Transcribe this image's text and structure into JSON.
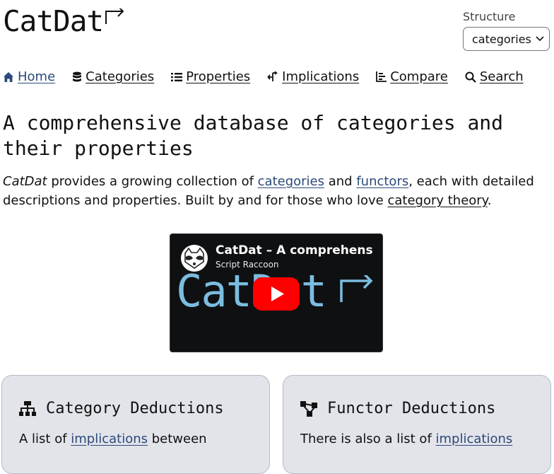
{
  "header": {
    "logo_text": "CatDat"
  },
  "structure": {
    "label": "Structure",
    "selected": "categories"
  },
  "nav": [
    {
      "label": "Home",
      "icon": "home-icon"
    },
    {
      "label": "Categories",
      "icon": "database-icon"
    },
    {
      "label": "Properties",
      "icon": "list-icon"
    },
    {
      "label": "Implications",
      "icon": "implication-icon"
    },
    {
      "label": "Compare",
      "icon": "compare-icon"
    },
    {
      "label": "Search",
      "icon": "search-icon"
    }
  ],
  "main": {
    "title": "A comprehensive database of categories and their properties",
    "intro": {
      "brand": "CatDat",
      "t1": " provides a growing collection of ",
      "link1": "categories",
      "t2": " and ",
      "link2": "functors",
      "t3": ", each with detailed descriptions and properties. Built by and for those who love ",
      "link3": "category theory",
      "t4": "."
    }
  },
  "video": {
    "title": "CatDat – A comprehensive database of categories",
    "channel": "Script Raccoon",
    "thumbnail_text": "CatDat"
  },
  "cards": [
    {
      "title": "Category Deductions",
      "text_before": "A list of ",
      "link": "implications",
      "text_after": " between",
      "icon": "hierarchy-icon"
    },
    {
      "title": "Functor Deductions",
      "text_before": "There is also a list of ",
      "link": "implications",
      "text_after": "",
      "icon": "nodes-icon"
    }
  ],
  "colors": {
    "link": "#2b4a7a",
    "card_bg": "#e3e4ea",
    "thumb_text": "#7bbde0",
    "play_red": "#ff0000"
  }
}
